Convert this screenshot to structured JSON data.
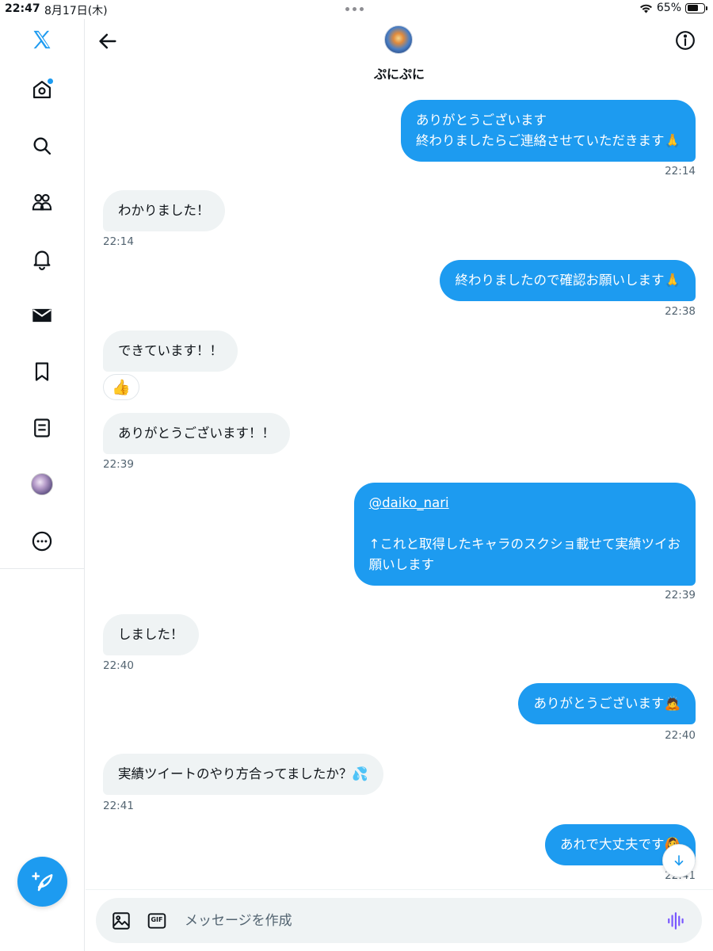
{
  "status_bar": {
    "time": "22:47",
    "date": "8月17日(木)",
    "battery": "65%"
  },
  "header": {
    "name": "ぷにぷに"
  },
  "messages": [
    {
      "dir": "out",
      "lines": [
        "ありがとうございます",
        "終わりましたらご連絡させていただきます🙏"
      ],
      "time": "22:14"
    },
    {
      "dir": "in",
      "lines": [
        "わかりました！"
      ],
      "time": "22:14"
    },
    {
      "dir": "out",
      "lines": [
        "終わりましたので確認お願いします🙏"
      ],
      "time": "22:38"
    },
    {
      "dir": "in",
      "lines": [
        "できています！！"
      ],
      "reaction": "👍"
    },
    {
      "dir": "in",
      "lines": [
        "ありがとうございます！！"
      ],
      "time": "22:39"
    },
    {
      "dir": "out",
      "mention": "@daiko_nari",
      "lines": [
        "↑これと取得したキャラのスクショ載せて実績ツイお",
        "願いします"
      ],
      "time": "22:39"
    },
    {
      "dir": "in",
      "lines": [
        "しました！"
      ],
      "time": "22:40"
    },
    {
      "dir": "out",
      "lines": [
        "ありがとうございます🙇"
      ],
      "time": "22:40"
    },
    {
      "dir": "in",
      "lines": [
        "実績ツイートのやり方合ってましたか？💦"
      ],
      "time": "22:41"
    },
    {
      "dir": "out",
      "lines": [
        "あれで大丈夫です🙆"
      ],
      "time": "22:41"
    }
  ],
  "composer": {
    "placeholder": "メッセージを作成",
    "gif_label": "GIF"
  },
  "colors": {
    "accent": "#1d9bf0",
    "incoming_bubble": "#eff3f4",
    "timestamp": "#536471"
  },
  "icons": {
    "sidebar": [
      "x-logo-icon",
      "home-icon",
      "search-icon",
      "communities-icon",
      "bell-icon",
      "mail-icon",
      "bookmark-icon",
      "lists-icon",
      "profile-avatar",
      "more-icon"
    ],
    "header": [
      "back-arrow-icon",
      "info-icon"
    ],
    "composer": [
      "image-icon",
      "gif-icon",
      "voice-icon"
    ],
    "floating": [
      "compose-icon",
      "arrow-down-icon"
    ]
  }
}
